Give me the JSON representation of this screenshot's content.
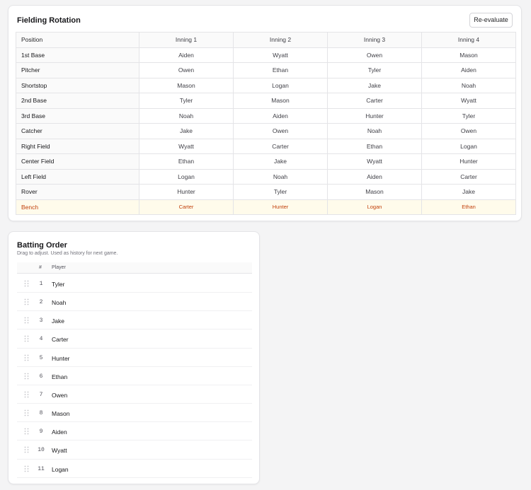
{
  "fielding": {
    "title": "Fielding Rotation",
    "reevaluate_label": "Re-evaluate",
    "columns": [
      "Position",
      "Inning 1",
      "Inning 2",
      "Inning 3",
      "Inning 4"
    ],
    "rows": [
      {
        "position": "1st Base",
        "innings": [
          "Aiden",
          "Wyatt",
          "Owen",
          "Mason"
        ]
      },
      {
        "position": "Pitcher",
        "innings": [
          "Owen",
          "Ethan",
          "Tyler",
          "Aiden"
        ]
      },
      {
        "position": "Shortstop",
        "innings": [
          "Mason",
          "Logan",
          "Jake",
          "Noah"
        ]
      },
      {
        "position": "2nd Base",
        "innings": [
          "Tyler",
          "Mason",
          "Carter",
          "Wyatt"
        ]
      },
      {
        "position": "3rd Base",
        "innings": [
          "Noah",
          "Aiden",
          "Hunter",
          "Tyler"
        ]
      },
      {
        "position": "Catcher",
        "innings": [
          "Jake",
          "Owen",
          "Noah",
          "Owen"
        ]
      },
      {
        "position": "Right Field",
        "innings": [
          "Wyatt",
          "Carter",
          "Ethan",
          "Logan"
        ]
      },
      {
        "position": "Center Field",
        "innings": [
          "Ethan",
          "Jake",
          "Wyatt",
          "Hunter"
        ]
      },
      {
        "position": "Left Field",
        "innings": [
          "Logan",
          "Noah",
          "Aiden",
          "Carter"
        ]
      },
      {
        "position": "Rover",
        "innings": [
          "Hunter",
          "Tyler",
          "Mason",
          "Jake"
        ]
      }
    ],
    "bench": {
      "position": "Bench",
      "innings": [
        "Carter",
        "Hunter",
        "Logan",
        "Ethan"
      ]
    },
    "bench_color": "#c2410c"
  },
  "batting": {
    "title": "Batting Order",
    "subtitle": "Drag to adjust. Used as history for next game.",
    "header_num": "#",
    "header_player": "Player",
    "rows": [
      {
        "num": "1",
        "player": "Tyler"
      },
      {
        "num": "2",
        "player": "Noah"
      },
      {
        "num": "3",
        "player": "Jake"
      },
      {
        "num": "4",
        "player": "Carter"
      },
      {
        "num": "5",
        "player": "Hunter"
      },
      {
        "num": "6",
        "player": "Ethan"
      },
      {
        "num": "7",
        "player": "Owen"
      },
      {
        "num": "8",
        "player": "Mason"
      },
      {
        "num": "9",
        "player": "Aiden"
      },
      {
        "num": "10",
        "player": "Wyatt"
      },
      {
        "num": "11",
        "player": "Logan"
      }
    ]
  }
}
